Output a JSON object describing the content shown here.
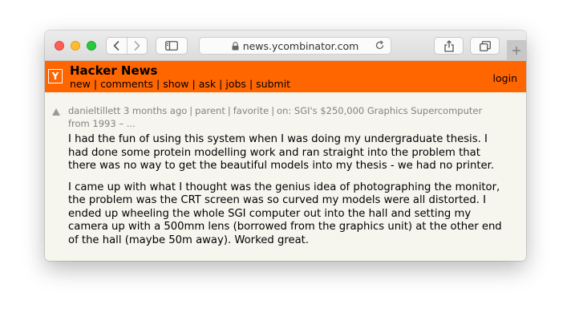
{
  "browser": {
    "url": "news.ycombinator.com",
    "icons": {
      "back": "chevron-left-icon",
      "forward": "chevron-right-icon",
      "sidebar": "sidebar-icon",
      "lock": "lock-icon",
      "reload": "reload-icon",
      "share": "share-icon",
      "tabs": "tabs-overview-icon",
      "new_tab": "plus-icon"
    }
  },
  "header": {
    "logo_letter": "Y",
    "title": "Hacker News",
    "nav": [
      "new",
      "comments",
      "show",
      "ask",
      "jobs",
      "submit"
    ],
    "separator": "|",
    "login": "login",
    "accent_color": "#ff6600"
  },
  "comment": {
    "user": "danieltillett",
    "age": "3 months ago",
    "parent": "parent",
    "favorite": "favorite",
    "on_prefix": "on:",
    "story": "SGI's $250,000 Graphics Supercomputer from 1993 – ...",
    "paragraphs": [
      "I had the fun of using this system when I was doing my undergraduate thesis. I had done some protein modelling work and ran straight into the problem that there was no way to get the beautiful models into my thesis - we had no printer.",
      "I came up with what I thought was the genius idea of photographing the monitor, the problem was the CRT screen was so curved my models were all distorted. I ended up wheeling the whole SGI computer out into the hall and setting my camera up with a 500mm lens (borrowed from the graphics unit) at the other end of the hall (maybe 50m away). Worked great."
    ]
  }
}
